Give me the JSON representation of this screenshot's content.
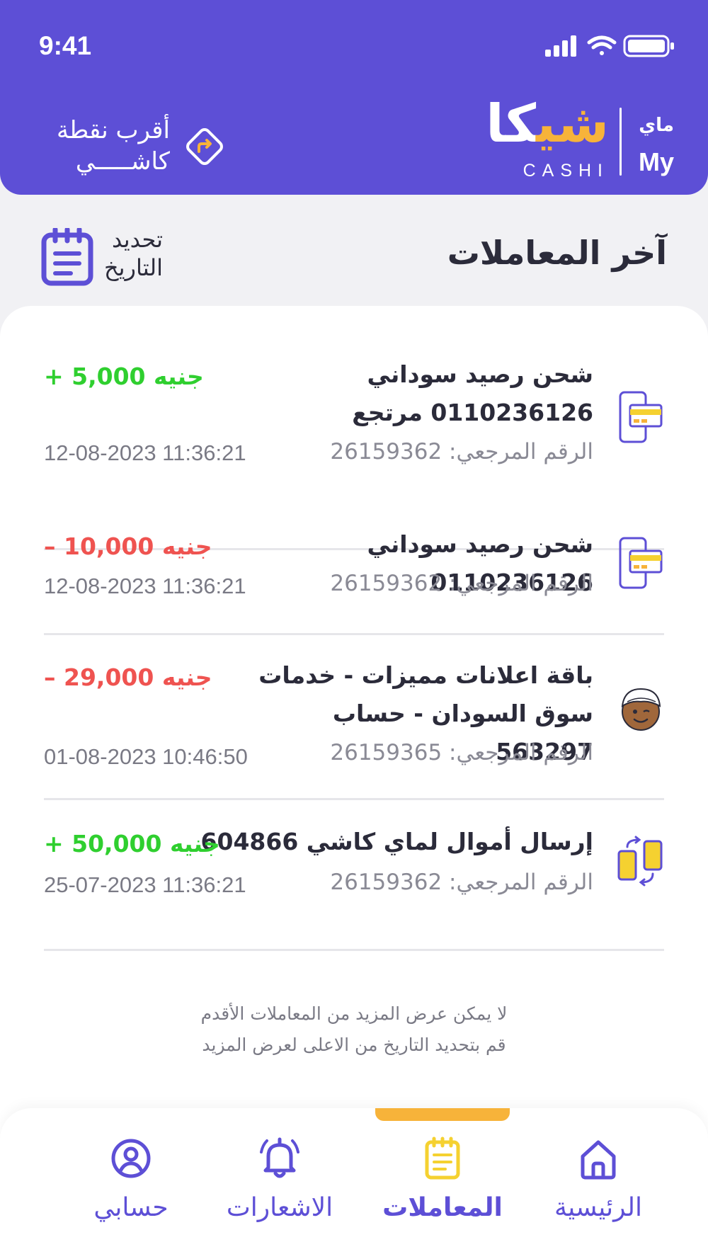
{
  "status_bar": {
    "time": "9:41"
  },
  "header": {
    "brand_my_ar": "ماي",
    "brand_my_en": "My",
    "brand_ar_white": "كا",
    "brand_ar_yellow": "شي",
    "brand_en": "CASHI",
    "nearest_point": "أقرب نقطة\nكاشـــــي"
  },
  "page": {
    "title": "آخر المعاملات",
    "date_filter": "تحديد\nالتاريخ"
  },
  "transactions": [
    {
      "description": "شحن رصيد سوداني 0110236126 مرتجع",
      "amount": "+ 5,000 جنيه",
      "direction": "credit",
      "reference": "الرقم المرجعي: 26159362",
      "datetime": "12-08-2023 11:36:21",
      "icon": "mobile-card-icon"
    },
    {
      "description": "شحن رصيد سوداني 0110236126",
      "amount": "– 10,000 جنيه",
      "direction": "debit",
      "reference": "الرقم المرجعي: 26159362",
      "datetime": "12-08-2023 11:36:21",
      "icon": "mobile-card-icon"
    },
    {
      "description": "باقة اعلانات مميزات - خدمات سوق السودان - حساب 563297",
      "amount": "– 29,000 جنيه",
      "direction": "debit",
      "reference": "الرقم المرجعي: 26159365",
      "datetime": "01-08-2023 10:46:50",
      "icon": "souq-mascot-icon"
    },
    {
      "description": "إرسال أموال لماي كاشي 604866",
      "amount": "+ 50,000 جنيه",
      "direction": "credit",
      "reference": "الرقم المرجعي: 26159362",
      "datetime": "25-07-2023 11:36:21",
      "icon": "phone-transfer-icon"
    }
  ],
  "notice": {
    "line1": "لا يمكن عرض المزيد من المعاملات الأقدم",
    "line2": "قم بتحديد التاريخ من الاعلى لعرض المزيد"
  },
  "nav": {
    "items": [
      {
        "label": "الرئيسية",
        "icon": "home-icon",
        "active": false
      },
      {
        "label": "المعاملات",
        "icon": "clipboard-icon",
        "active": true
      },
      {
        "label": "الاشعارات",
        "icon": "bell-icon",
        "active": false
      },
      {
        "label": "حسابي",
        "icon": "user-circle-icon",
        "active": false
      }
    ]
  },
  "colors": {
    "primary": "#5d4fd6",
    "accent": "#f7b33a",
    "credit": "#2fcf2f",
    "debit": "#ef5350"
  }
}
